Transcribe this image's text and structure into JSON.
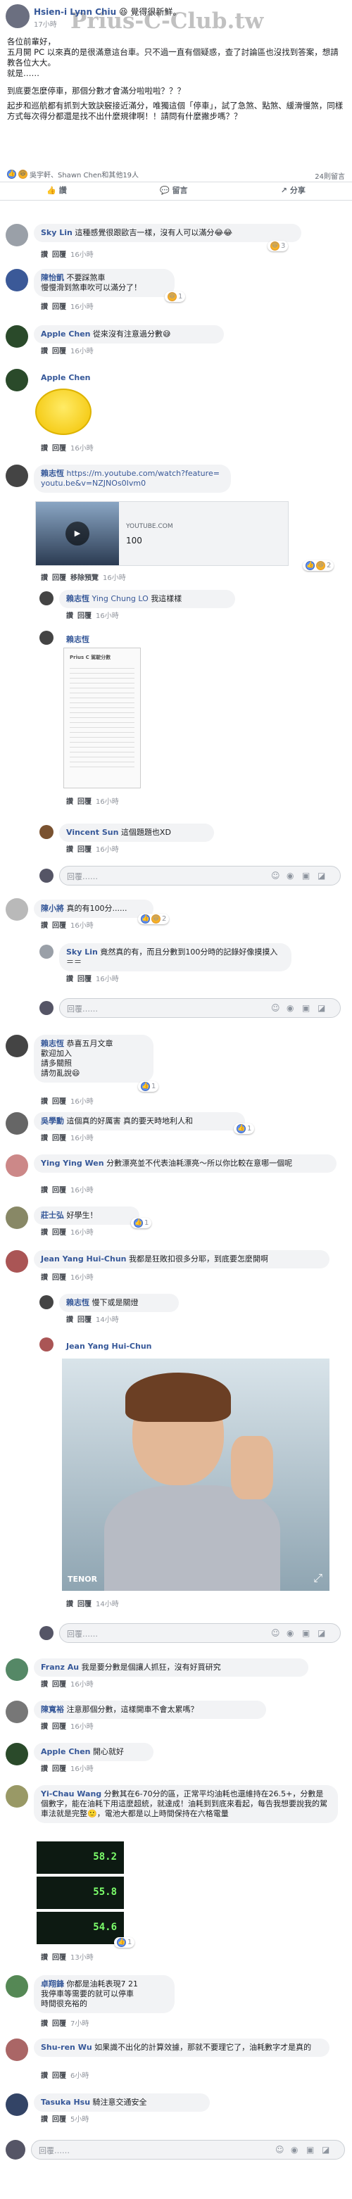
{
  "watermark": "Prius-C-Club.tw",
  "post": {
    "author": "Hsien-i Lynn Chiu",
    "feeling": "覺得很新鮮。",
    "time": "17小時",
    "body": [
      "各位前輩好，",
      "五月開 PC 以來真的是很滿意這台車。只不過一直有個疑惑，查了討論區也沒找到答案，想請教各位大大。",
      "就是……",
      "到底要怎麼停車，那個分數才會滿分啦啦啦？？？",
      "起步和巡航都有抓到大致訣竅接近滿分，唯獨這個「停車」，試了急煞、點煞、緩滑慢煞，同樣方式每次得分都還是找不出什麼規律啊！！請問有什麼撇步嗎？？"
    ],
    "reaction_summary": "吳宇軒、Shawn Chen和其他19人",
    "comment_count": "24則留言",
    "buttons": {
      "like": "讚",
      "comment": "留言",
      "share": "分享"
    }
  },
  "labels": {
    "like": "讚",
    "reply": "回覆",
    "remove_preview": "移除預覽",
    "placeholder": "回覆……"
  },
  "comments": [
    {
      "name": "Sky Lin",
      "text": "這種感覺很跟歐吉一樣，沒有人可以滿分😂😂",
      "time": "16小時",
      "react": "3"
    },
    {
      "name": "陳怡凱",
      "text": "不要踩煞車\n慢慢滑到煞車吹可以滿分了！",
      "time": "16小時",
      "react": "1"
    },
    {
      "name": "Apple Chen",
      "text": "從來沒有注意過分數😅",
      "time": "16小時"
    },
    {
      "name": "Apple Chen",
      "text": "",
      "time": "16小時"
    },
    {
      "name": "賴志恆",
      "link": "https://m.youtube.com/watch?feature=youtu.be&v=NZJNOs0Ivm0",
      "preview_site": "YOUTUBE.COM",
      "preview_title": "100",
      "time": "16小時",
      "react": "2"
    },
    {
      "name": "賴志恆",
      "mention": "Ying Chung LO",
      "text": "我這樣樣",
      "time": "16小時"
    },
    {
      "name": "賴志恆",
      "time": "16小時"
    },
    {
      "name": "Vincent Sun",
      "text": "這個題題也XD",
      "time": "16小時"
    },
    {
      "name": "陳小將",
      "text": "真的有100分......",
      "time": "16小時",
      "react": "2"
    },
    {
      "name": "Sky Lin",
      "text": "竟然真的有，而且分數到100分時的記錄好像摸摸入＝＝",
      "time": "16小時"
    },
    {
      "name": "賴志恆",
      "text": "恭喜五月文章\n歡迎加入\n請多關照\n請勿亂說😄",
      "time": "16小時",
      "react": "1"
    },
    {
      "name": "吳學勳",
      "text": "這個真的好厲害 真的要天時地利人和",
      "time": "16小時",
      "react": "1"
    },
    {
      "name": "Ying Ying Wen",
      "text": "分數漂亮並不代表油耗漂亮～所以你比較在意哪一個呢",
      "time": "16小時"
    },
    {
      "name": "莊士弘",
      "text": "好學生！",
      "time": "16小時",
      "react": "1"
    },
    {
      "name": "Jean Yang Hui-Chun",
      "text": "我都是狂敗扣很多分耶，到底要怎麼開啊",
      "time": "16小時"
    },
    {
      "name": "賴志恆",
      "text": "慢下或是關燈",
      "time": "14小時"
    },
    {
      "name": "Jean Yang Hui-Chun",
      "gif": "TENOR",
      "time": "14小時"
    },
    {
      "name": "Franz Au",
      "text": "我是要分數是個讓人抓狂，沒有好買研究",
      "time": "16小時"
    },
    {
      "name": "陳寬裕",
      "text": "注意那個分數，這樣開車不會太累嗎？",
      "time": "16小時"
    },
    {
      "name": "Apple Chen",
      "text": "開心就好",
      "time": "16小時"
    },
    {
      "name": "Yi-Chau Wang",
      "text": "分數其在6-70分的區，正常平均油耗也還維持在26.5+，分數是個數字，能在油耗下用這麼超統，就達成！油耗到到底來看起，每告我想要說我的駕車法就是完整🙂，電池大都是以上時間保持在六格電量",
      "time": "13小時",
      "react": "1"
    },
    {
      "name": "卓翔鋒",
      "text": "你都是油耗表現7 21\n我停車等需要的就可以停車\n時間很充裕的",
      "time": "7小時"
    },
    {
      "name": "Shu-ren Wu",
      "text": "如果識不出化的計算效據，那就不要理它了，油耗數字才是真的",
      "time": "6小時"
    },
    {
      "name": "Tasuka Hsu",
      "text": "騎注意交通安全",
      "time": "5小時"
    }
  ],
  "attachment_caption": "Prius C 駕駛分數",
  "screen_nums": [
    "58.2",
    "55.8",
    "54.6"
  ]
}
